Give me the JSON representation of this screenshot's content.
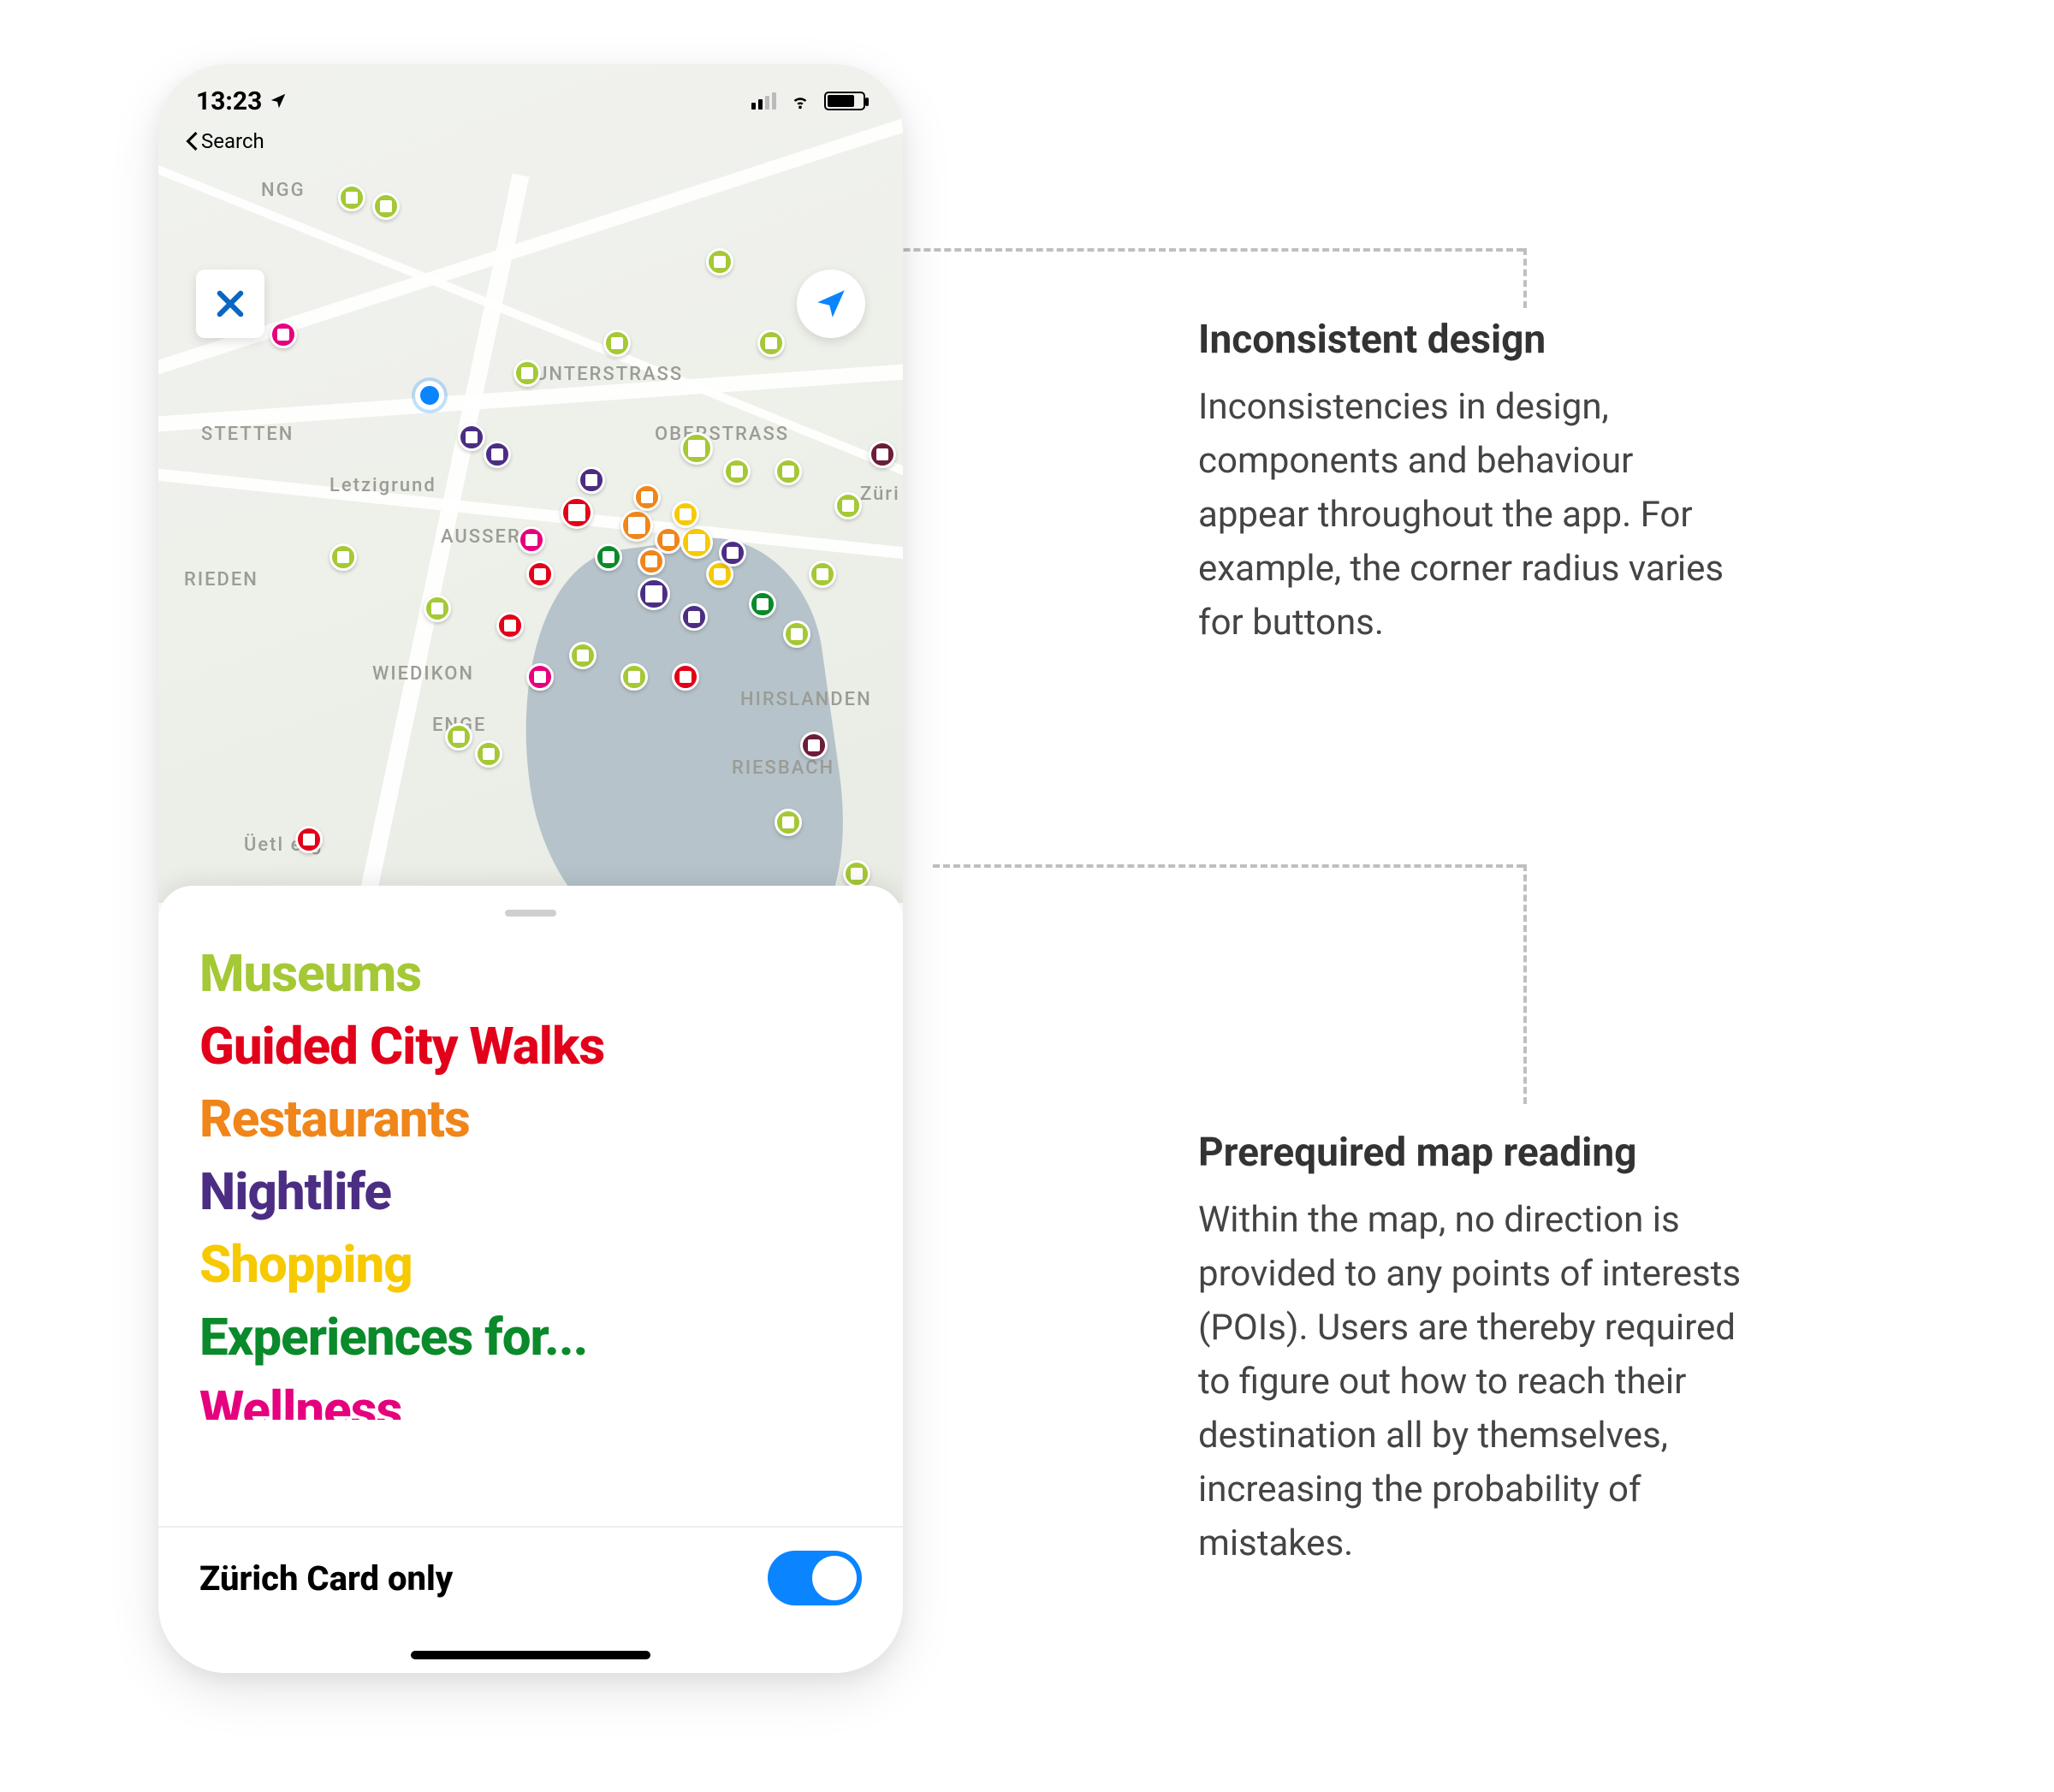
{
  "status_bar": {
    "time": "13:23",
    "back_label": "Search"
  },
  "map": {
    "labels": {
      "unterstrass": "UNTERSTRASS",
      "oberstrass": "OBERSTRASS",
      "stetten": "STETTEN",
      "letzigrund": "Letzigrund",
      "aussers": "AUSSERS",
      "rieden": "RIEDEN",
      "wiedikon": "WIEDIKON",
      "enge": "ENGE",
      "hirslanden": "HIRSLANDEN",
      "riesbach": "RIESBACH",
      "zuri": "Züri",
      "uetliberg": "Üetl   erg",
      "ngg": "NGG"
    }
  },
  "categories": [
    {
      "label": "Museums",
      "color": "#a5c836"
    },
    {
      "label": "Guided City Walks",
      "color": "#e2001a"
    },
    {
      "label": "Restaurants",
      "color": "#f08519"
    },
    {
      "label": "Nightlife",
      "color": "#4b2e83"
    },
    {
      "label": "Shopping",
      "color": "#f6c900"
    },
    {
      "label": "Experiences for...",
      "color": "#0a8a2a"
    },
    {
      "label": "Wellness",
      "color": "#e6007e"
    }
  ],
  "footer": {
    "label": "Zürich Card only",
    "toggle_on": true
  },
  "annotations": {
    "a1": {
      "title": "Inconsistent design",
      "body": "Inconsistencies in design, components and behaviour appear throughout the app. For example, the corner radius varies for buttons."
    },
    "a2": {
      "title": "Prerequired map reading",
      "body": "Within the map, no direction is provided to any points of interests (POIs). Users are thereby required to figure out how to reach their destination all by themselves, increasing the probability of mistakes."
    }
  }
}
